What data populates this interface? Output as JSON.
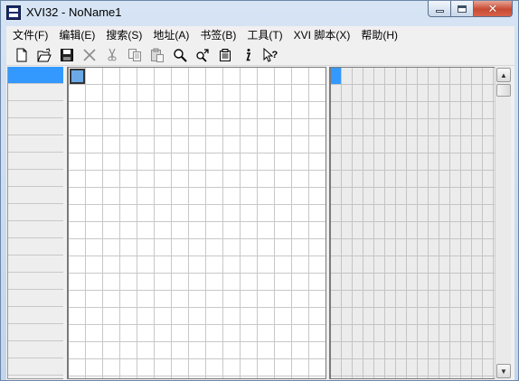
{
  "window": {
    "title": "XVI32 - NoName1"
  },
  "menu": [
    {
      "id": "file",
      "label": "文件(F)"
    },
    {
      "id": "edit",
      "label": "编辑(E)"
    },
    {
      "id": "search",
      "label": "搜索(S)"
    },
    {
      "id": "address",
      "label": "地址(A)"
    },
    {
      "id": "bookmarks",
      "label": "书签(B)"
    },
    {
      "id": "tools",
      "label": "工具(T)"
    },
    {
      "id": "script",
      "label": "XVI 脚本(X)"
    },
    {
      "id": "help",
      "label": "帮助(H)"
    }
  ],
  "toolbar": [
    {
      "name": "new-file-icon"
    },
    {
      "name": "open-folder-icon"
    },
    {
      "name": "save-disk-icon"
    },
    {
      "name": "delete-x-icon"
    },
    {
      "name": "cut-scissors-icon"
    },
    {
      "name": "copy-icon"
    },
    {
      "name": "paste-icon"
    },
    {
      "name": "find-magnifier-icon"
    },
    {
      "name": "find-next-icon"
    },
    {
      "name": "properties-icon"
    },
    {
      "name": "info-icon"
    },
    {
      "name": "context-help-icon"
    }
  ],
  "colors": {
    "selection": "#3399ff",
    "grid": "#c8c8c8"
  }
}
